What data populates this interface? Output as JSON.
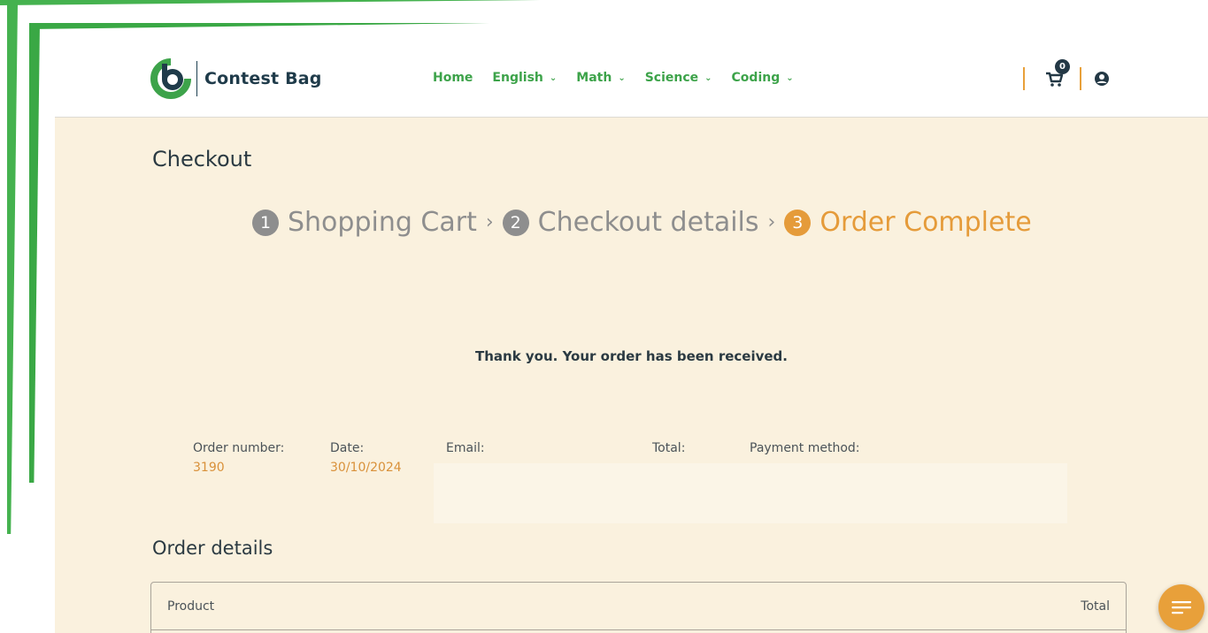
{
  "brand": {
    "name": "Contest Bag"
  },
  "nav": [
    {
      "label": "Home",
      "has_dropdown": false
    },
    {
      "label": "English",
      "has_dropdown": true
    },
    {
      "label": "Math",
      "has_dropdown": true
    },
    {
      "label": "Science",
      "has_dropdown": true
    },
    {
      "label": "Coding",
      "has_dropdown": true
    }
  ],
  "header": {
    "cart_count": "0",
    "icons": [
      "cart-icon",
      "user-icon"
    ]
  },
  "page": {
    "title": "Checkout"
  },
  "steps": [
    {
      "number": "1",
      "label": "Shopping Cart",
      "active": false
    },
    {
      "number": "2",
      "label": "Checkout details",
      "active": false
    },
    {
      "number": "3",
      "label": "Order Complete",
      "active": true
    }
  ],
  "step_separator": "›",
  "thanks_message": "Thank you. Your order has been received.",
  "order_overview": {
    "order_number": {
      "label": "Order number:",
      "value": "3190"
    },
    "date": {
      "label": "Date:",
      "value": "30/10/2024"
    },
    "email": {
      "label": "Email:",
      "value": ""
    },
    "total": {
      "label": "Total:",
      "value": ""
    },
    "payment_method": {
      "label": "Payment method:",
      "value": ""
    }
  },
  "order_details": {
    "title": "Order details",
    "columns": [
      "Product",
      "Total"
    ]
  },
  "colors": {
    "brand_green": "#3da34a",
    "accent_orange": "#e59b3a",
    "page_bg": "#faf1de",
    "text_dark": "#2b3a42"
  }
}
